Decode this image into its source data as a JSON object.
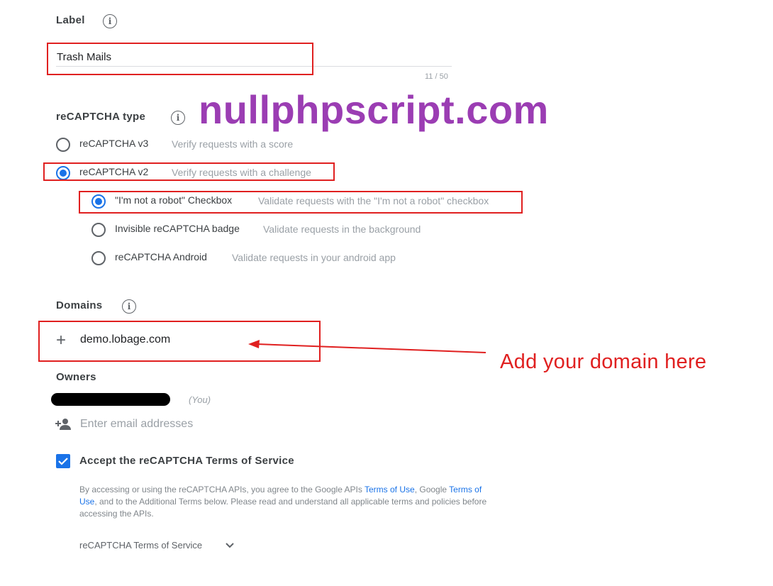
{
  "label_section": {
    "title": "Label",
    "value": "Trash Mails",
    "counter": "11 / 50"
  },
  "watermark": "nullphpscript.com",
  "recaptcha_type": {
    "title": "reCAPTCHA type",
    "options": [
      {
        "label": "reCAPTCHA v3",
        "description": "Verify requests with a score",
        "selected": false
      },
      {
        "label": "reCAPTCHA v2",
        "description": "Verify requests with a challenge",
        "selected": true
      }
    ],
    "v2_options": [
      {
        "label": "\"I'm not a robot\" Checkbox",
        "description": "Validate requests with the \"I'm not a robot\" checkbox",
        "selected": true
      },
      {
        "label": "Invisible reCAPTCHA badge",
        "description": "Validate requests in the background",
        "selected": false
      },
      {
        "label": "reCAPTCHA Android",
        "description": "Validate requests in your android app",
        "selected": false
      }
    ]
  },
  "domains": {
    "title": "Domains",
    "value": "demo.lobage.com",
    "add_icon": "plus-icon"
  },
  "annotation": "Add your domain here",
  "owners": {
    "title": "Owners",
    "you_label": "(You)",
    "email_placeholder": "Enter email addresses",
    "add_icon": "person-add-icon"
  },
  "terms": {
    "title": "Accept the reCAPTCHA Terms of Service",
    "checked": true,
    "body_part1": "By accessing or using the reCAPTCHA APIs, you agree to the Google APIs ",
    "link1": "Terms of Use",
    "body_part2": ", Google ",
    "link2": "Terms of Use",
    "body_part3": ", and to the Additional Terms below. Please read and understand all applicable terms and policies before accessing the APIs.",
    "dropdown_label": "reCAPTCHA Terms of Service"
  },
  "colors": {
    "accent": "#1a73e8",
    "highlight": "#e02020",
    "watermark": "#9b3db3"
  }
}
